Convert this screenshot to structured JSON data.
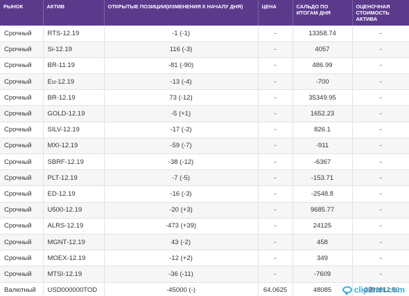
{
  "table": {
    "headers": {
      "market": "РЫНОК",
      "asset": "АКТИВ",
      "positions": "ОТКРЫТЫЕ ПОЗИЦИИ(ИЗМЕНЕНИЯ К НАЧАЛУ ДНЯ)",
      "price": "ЦЕНА",
      "saldo": "САЛЬДО ПО ИТОГАМ ДНЯ",
      "estimate": "ОЦЕНОЧНАЯ СТОИМОСТЬ АКТИВА"
    },
    "rows": [
      {
        "market": "Срочный",
        "asset": "RTS-12.19",
        "positions": "-1 (-1)",
        "price": "-",
        "saldo": "13358.74",
        "estimate": "-"
      },
      {
        "market": "Срочный",
        "asset": "Si-12.19",
        "positions": "116 (-3)",
        "price": "-",
        "saldo": "4057",
        "estimate": "-"
      },
      {
        "market": "Срочный",
        "asset": "BR-11.19",
        "positions": "-81 (-90)",
        "price": "-",
        "saldo": "486.99",
        "estimate": "-"
      },
      {
        "market": "Срочный",
        "asset": "Eu-12.19",
        "positions": "-13 (-4)",
        "price": "-",
        "saldo": "-700",
        "estimate": "-"
      },
      {
        "market": "Срочный",
        "asset": "BR-12.19",
        "positions": "73 (-12)",
        "price": "-",
        "saldo": "35349.95",
        "estimate": "-"
      },
      {
        "market": "Срочный",
        "asset": "GOLD-12.19",
        "positions": "-5 (+1)",
        "price": "-",
        "saldo": "1652.23",
        "estimate": "-"
      },
      {
        "market": "Срочный",
        "asset": "SILV-12.19",
        "positions": "-17 (-2)",
        "price": "-",
        "saldo": "826.1",
        "estimate": "-"
      },
      {
        "market": "Срочный",
        "asset": "MXI-12.19",
        "positions": "-59 (-7)",
        "price": "-",
        "saldo": "-911",
        "estimate": "-"
      },
      {
        "market": "Срочный",
        "asset": "SBRF-12.19",
        "positions": "-38 (-12)",
        "price": "-",
        "saldo": "-6367",
        "estimate": "-"
      },
      {
        "market": "Срочный",
        "asset": "PLT-12.19",
        "positions": "-7 (-5)",
        "price": "-",
        "saldo": "-153.71",
        "estimate": "-"
      },
      {
        "market": "Срочный",
        "asset": "ED-12.19",
        "positions": "-16 (-3)",
        "price": "-",
        "saldo": "-2548.8",
        "estimate": "-"
      },
      {
        "market": "Срочный",
        "asset": "U500-12.19",
        "positions": "-20 (+3)",
        "price": "-",
        "saldo": "9685.77",
        "estimate": "-"
      },
      {
        "market": "Срочный",
        "asset": "ALRS-12.19",
        "positions": "-473 (+39)",
        "price": "-",
        "saldo": "24125",
        "estimate": "-"
      },
      {
        "market": "Срочный",
        "asset": "MGNT-12.19",
        "positions": "43 (-2)",
        "price": "-",
        "saldo": "458",
        "estimate": "-"
      },
      {
        "market": "Срочный",
        "asset": "MOEX-12.19",
        "positions": "-12 (+2)",
        "price": "-",
        "saldo": "349",
        "estimate": "-"
      },
      {
        "market": "Срочный",
        "asset": "MTSI-12.19",
        "positions": "-36 (-11)",
        "price": "-",
        "saldo": "-7609",
        "estimate": "-"
      },
      {
        "market": "Валютный",
        "asset": "USD000000TOD",
        "positions": "-45000 (-)",
        "price": "64.0625",
        "saldo": "48085",
        "estimate": "-2882812.50"
      }
    ]
  },
  "watermark": {
    "text": "clip2net.com",
    "color": "#29a3d6"
  },
  "colors": {
    "header_bg": "#5b3a8c",
    "header_text": "#ffffff",
    "row_alt": "#f6f6f6",
    "border": "#e2e2e2"
  }
}
